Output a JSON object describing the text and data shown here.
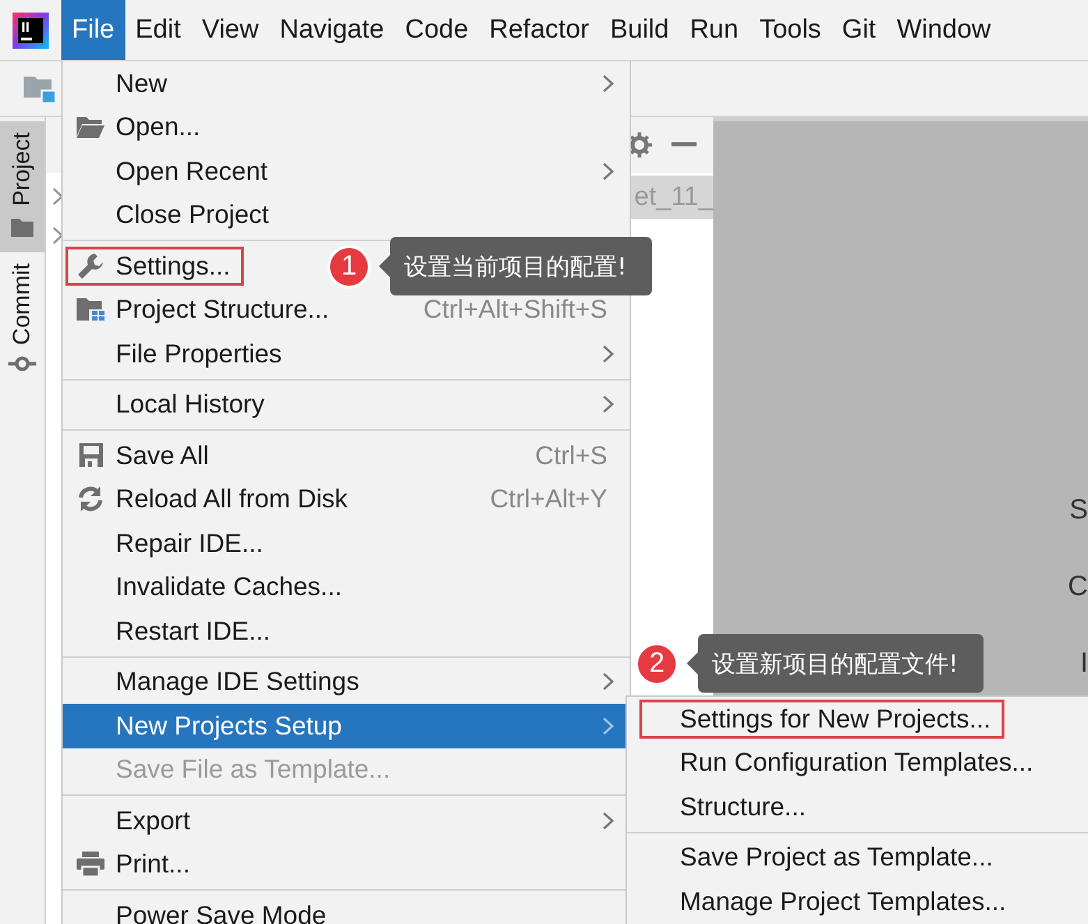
{
  "menu_bar": {
    "items": [
      {
        "label": "File",
        "selected": true
      },
      {
        "label": "Edit",
        "selected": false
      },
      {
        "label": "View",
        "selected": false
      },
      {
        "label": "Navigate",
        "selected": false
      },
      {
        "label": "Code",
        "selected": false
      },
      {
        "label": "Refactor",
        "selected": false
      },
      {
        "label": "Build",
        "selected": false
      },
      {
        "label": "Run",
        "selected": false
      },
      {
        "label": "Tools",
        "selected": false
      },
      {
        "label": "Git",
        "selected": false
      },
      {
        "label": "Window",
        "selected": false
      }
    ]
  },
  "tool_window_strip": {
    "tabs": [
      {
        "label": "Project",
        "selected": true
      },
      {
        "label": "Commit",
        "selected": false
      }
    ]
  },
  "project_panel": {
    "rows": [
      {
        "label": "et_11_",
        "selected": true
      }
    ]
  },
  "editor_fragments": [
    "S",
    "C",
    "I"
  ],
  "file_menu": {
    "items": [
      {
        "kind": "item",
        "label": "New",
        "submenu": true,
        "selected": false,
        "disabled": false,
        "highlighted": false
      },
      {
        "kind": "item",
        "label": "Open...",
        "submenu": false,
        "selected": false,
        "disabled": false,
        "highlighted": false
      },
      {
        "kind": "item",
        "label": "Open Recent",
        "submenu": true,
        "selected": false,
        "disabled": false,
        "highlighted": false
      },
      {
        "kind": "item",
        "label": "Close Project",
        "submenu": false,
        "selected": false,
        "disabled": false,
        "highlighted": false
      },
      {
        "kind": "separator"
      },
      {
        "kind": "item",
        "label": "Settings...",
        "submenu": false,
        "selected": false,
        "disabled": false,
        "highlighted": true
      },
      {
        "kind": "item",
        "label": "Project Structure...",
        "shortcut": "Ctrl+Alt+Shift+S",
        "submenu": false,
        "selected": false,
        "disabled": false,
        "highlighted": false
      },
      {
        "kind": "item",
        "label": "File Properties",
        "submenu": true,
        "selected": false,
        "disabled": false,
        "highlighted": false
      },
      {
        "kind": "separator"
      },
      {
        "kind": "item",
        "label": "Local History",
        "submenu": true,
        "selected": false,
        "disabled": false,
        "highlighted": false
      },
      {
        "kind": "separator"
      },
      {
        "kind": "item",
        "label": "Save All",
        "shortcut": "Ctrl+S",
        "submenu": false,
        "selected": false,
        "disabled": false,
        "highlighted": false
      },
      {
        "kind": "item",
        "label": "Reload All from Disk",
        "shortcut": "Ctrl+Alt+Y",
        "submenu": false,
        "selected": false,
        "disabled": false,
        "highlighted": false
      },
      {
        "kind": "item",
        "label": "Repair IDE...",
        "submenu": false,
        "selected": false,
        "disabled": false,
        "highlighted": false
      },
      {
        "kind": "item",
        "label": "Invalidate Caches...",
        "submenu": false,
        "selected": false,
        "disabled": false,
        "highlighted": false
      },
      {
        "kind": "item",
        "label": "Restart IDE...",
        "submenu": false,
        "selected": false,
        "disabled": false,
        "highlighted": false
      },
      {
        "kind": "separator"
      },
      {
        "kind": "item",
        "label": "Manage IDE Settings",
        "submenu": true,
        "selected": false,
        "disabled": false,
        "highlighted": false
      },
      {
        "kind": "item",
        "label": "New Projects Setup",
        "submenu": true,
        "selected": true,
        "disabled": false,
        "highlighted": false
      },
      {
        "kind": "item",
        "label": "Save File as Template...",
        "submenu": false,
        "selected": false,
        "disabled": true,
        "highlighted": false
      },
      {
        "kind": "separator"
      },
      {
        "kind": "item",
        "label": "Export",
        "submenu": true,
        "selected": false,
        "disabled": false,
        "highlighted": false
      },
      {
        "kind": "item",
        "label": "Print...",
        "submenu": false,
        "selected": false,
        "disabled": false,
        "highlighted": false
      },
      {
        "kind": "separator"
      },
      {
        "kind": "item",
        "label": "Power Save Mode",
        "submenu": false,
        "selected": false,
        "disabled": false,
        "highlighted": false
      }
    ]
  },
  "submenu": {
    "items": [
      {
        "kind": "item",
        "label": "Settings for New Projects...",
        "submenu": false,
        "selected": false,
        "disabled": false,
        "highlighted": true
      },
      {
        "kind": "item",
        "label": "Run Configuration Templates...",
        "submenu": false,
        "selected": false,
        "disabled": false,
        "highlighted": false
      },
      {
        "kind": "item",
        "label": "Structure...",
        "submenu": false,
        "selected": false,
        "disabled": false,
        "highlighted": false
      },
      {
        "kind": "separator"
      },
      {
        "kind": "item",
        "label": "Save Project as Template...",
        "submenu": false,
        "selected": false,
        "disabled": false,
        "highlighted": false
      },
      {
        "kind": "item",
        "label": "Manage Project Templates...",
        "submenu": false,
        "selected": false,
        "disabled": false,
        "highlighted": false
      }
    ]
  },
  "annotations": [
    {
      "number": "1",
      "text": "设置当前项目的配置!"
    },
    {
      "number": "2",
      "text": "设置新项目的配置文件!"
    }
  ]
}
